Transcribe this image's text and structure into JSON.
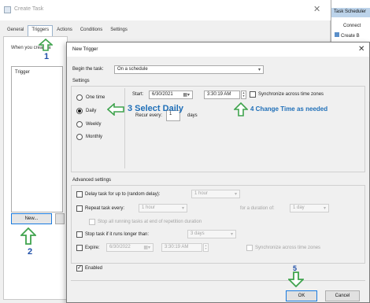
{
  "create_task": {
    "title": "Create Task",
    "tabs": [
      "General",
      "Triggers",
      "Actions",
      "Conditions",
      "Settings"
    ],
    "when_text": "When you create a",
    "list_header": "Trigger",
    "new_button": "New..."
  },
  "right_panel": {
    "header": "Task Scheduler",
    "items": [
      "Connect",
      "Create B"
    ]
  },
  "dialog": {
    "title": "New Trigger",
    "begin_label": "Begin the task:",
    "begin_value": "On a schedule",
    "settings_label": "Settings",
    "radios": [
      "One time",
      "Daily",
      "Weekly",
      "Monthly"
    ],
    "selected_radio": "Daily",
    "start_label": "Start:",
    "start_date": "6/30/2021",
    "start_time": "3:30:19 AM",
    "sync_label": "Synchronize across time zones",
    "recur_label": "Recur every:",
    "recur_value": "1",
    "recur_unit": "days",
    "advanced_label": "Advanced settings",
    "delay_label": "Delay task for up to (random delay):",
    "delay_value": "1 hour",
    "repeat_label": "Repeat task every:",
    "repeat_value": "1 hour",
    "duration_label": "for a duration of:",
    "duration_value": "1 day",
    "stop_running_label": "Stop all running tasks at end of repetition duration",
    "stop_longer_label": "Stop task if it runs longer than:",
    "stop_longer_value": "3 days",
    "expire_label": "Expire:",
    "expire_date": "6/30/2022",
    "expire_time": "3:30:19 AM",
    "expire_sync_label": "Synchronize across time zones",
    "enabled_label": "Enabled",
    "ok_label": "OK",
    "cancel_label": "Cancel"
  },
  "annotations": {
    "step1": "1",
    "step2": "2",
    "step3": "3 Select Daily",
    "step4": "4 Change Time as needed",
    "step5": "5"
  },
  "colors": {
    "arrow_green": "#3fa34d",
    "annotation_blue": "#1f6fb8",
    "focus_blue": "#1a7be0"
  }
}
